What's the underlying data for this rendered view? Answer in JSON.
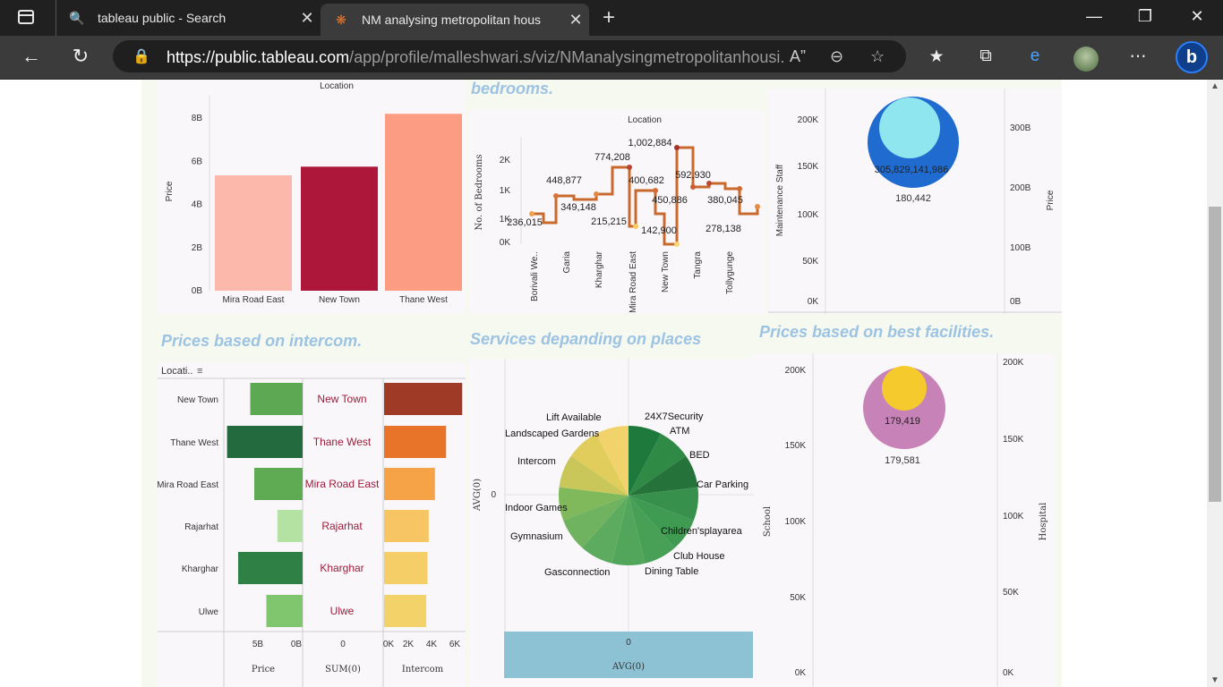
{
  "browser": {
    "tabs": [
      {
        "title": "tableau public - Search"
      },
      {
        "title": "NM analysing metropolitan hous"
      }
    ],
    "url_host": "https://public.tableau.com",
    "url_path": "/app/profile/malleshwari.s/viz/NManalysingmetropolitanhousi...",
    "icons": [
      "back-icon",
      "refresh-icon",
      "lock-icon",
      "read-aloud-icon",
      "zoom-out-icon",
      "add-favorite-icon",
      "favorites-icon",
      "collections-icon",
      "edge-icon",
      "profile-avatar",
      "more-icon",
      "bing-icon"
    ]
  },
  "headings": {
    "bedrooms": "bedrooms.",
    "intercom": "Prices based on intercom.",
    "services": "Services depanding on places",
    "facilities": "Prices based on best facilities."
  },
  "bar_chart": {
    "location_label": "Location",
    "ylabel": "Price",
    "yticks": [
      "0B",
      "2B",
      "4B",
      "6B",
      "8B"
    ],
    "categories": [
      "Mira Road East",
      "New Town",
      "Thane West"
    ],
    "colors": [
      "#fcb8aa",
      "#ad1739",
      "#fc9c82"
    ]
  },
  "line_chart": {
    "location_label": "Location",
    "ylabel": "No. of Bedrooms",
    "yticks": [
      "0K",
      "1K",
      "1K",
      "2K"
    ],
    "categories": [
      "Borivali We..",
      "Garia",
      "Kharghar",
      "Mira Road East",
      "New Town",
      "Tangra",
      "Tollygunge"
    ],
    "labels": [
      "236,015",
      "448,877",
      "349,148",
      "774,208",
      "215,215",
      "400,682",
      "1,002,884",
      "142,900",
      "450,886",
      "592,930",
      "380,045",
      "278,138"
    ]
  },
  "bubble_chart_1": {
    "ylabel_left": "Maintenance Staff",
    "ylabel_right": "Price",
    "left_ticks": [
      "0K",
      "50K",
      "100K",
      "150K",
      "200K"
    ],
    "right_ticks": [
      "0B",
      "100B",
      "200B",
      "300B"
    ],
    "inner_label": "305,829,141,986",
    "outer_label": "180,442"
  },
  "intercom_chart": {
    "location_header": "Locati..",
    "rows": [
      "New Town",
      "Thane West",
      "Mira Road East",
      "Rajarhat",
      "Kharghar",
      "Ulwe"
    ],
    "price_ticks": [
      "5B",
      "0B"
    ],
    "sum_tick": "0",
    "intercom_ticks": [
      "0K",
      "2K",
      "4K",
      "6K"
    ],
    "col_labels": [
      "Price",
      "SUM(0)",
      "Intercom"
    ]
  },
  "pie_chart": {
    "ylabel": "AVG(0)",
    "y_tick": "0",
    "x_tick": "0",
    "xlabel": "AVG(0)",
    "slices": [
      "24X7Security",
      "ATM",
      "BED",
      "Car Parking",
      "Children'splayarea",
      "Club House",
      "Dining Table",
      "Gasconnection",
      "Gymnasium",
      "Indoor Games",
      "Intercom",
      "Landscaped Gardens",
      "Lift Available"
    ]
  },
  "bubble_chart_2": {
    "ylabel_left": "School",
    "ylabel_right": "Hospital",
    "left_ticks": [
      "0K",
      "50K",
      "100K",
      "150K",
      "200K"
    ],
    "right_ticks": [
      "0K",
      "50K",
      "100K",
      "150K",
      "200K"
    ],
    "inner_label": "179,419",
    "outer_label": "179,581"
  },
  "chart_data": [
    {
      "type": "bar",
      "title": "",
      "xlabel": "Location",
      "ylabel": "Price",
      "categories": [
        "Mira Road East",
        "New Town",
        "Thane West"
      ],
      "values": [
        5.35,
        5.75,
        8.2
      ],
      "unit": "B",
      "ylim": [
        0,
        8.5
      ]
    },
    {
      "type": "line",
      "xlabel": "Location",
      "ylabel": "No. of Bedrooms",
      "categories": [
        "Borivali We..",
        "Garia",
        "Kharghar",
        "Mira Road East",
        "New Town",
        "Tangra",
        "Tollygunge"
      ],
      "labels": [
        "236,015",
        "448,877",
        "349,148",
        "774,208",
        "215,215",
        "400,682",
        "1,002,884",
        "142,900",
        "450,886",
        "592,930",
        "380,045",
        "278,138"
      ]
    },
    {
      "type": "bar",
      "title": "Prices based on intercom.",
      "categories": [
        "New Town",
        "Thane West",
        "Mira Road East",
        "Rajarhat",
        "Kharghar",
        "Ulwe"
      ],
      "series": [
        {
          "name": "Price",
          "values": [
            -5.2,
            -7.5,
            -4.8,
            -2.5,
            -6.4,
            -3.6
          ],
          "unit": "B"
        },
        {
          "name": "Intercom",
          "values": [
            6.3,
            5.0,
            4.1,
            3.6,
            3.5,
            3.4
          ],
          "unit": "K"
        }
      ]
    },
    {
      "type": "pie",
      "title": "Services depanding on places",
      "categories": [
        "24X7Security",
        "ATM",
        "BED",
        "Car Parking",
        "Children'splayarea",
        "Club House",
        "Dining Table",
        "Gasconnection",
        "Gymnasium",
        "Indoor Games",
        "Intercom",
        "Landscaped Gardens",
        "Lift Available"
      ]
    },
    {
      "type": "scatter",
      "title": "Prices based on best facilities.",
      "series": [
        {
          "name": "School",
          "values": [
            179581
          ]
        },
        {
          "name": "Hospital",
          "values": [
            179419
          ]
        }
      ]
    }
  ],
  "colors": {
    "heading": "#9cc3e3",
    "bar_dark": "#ad1739",
    "intercom_red": "#9e3a26"
  }
}
